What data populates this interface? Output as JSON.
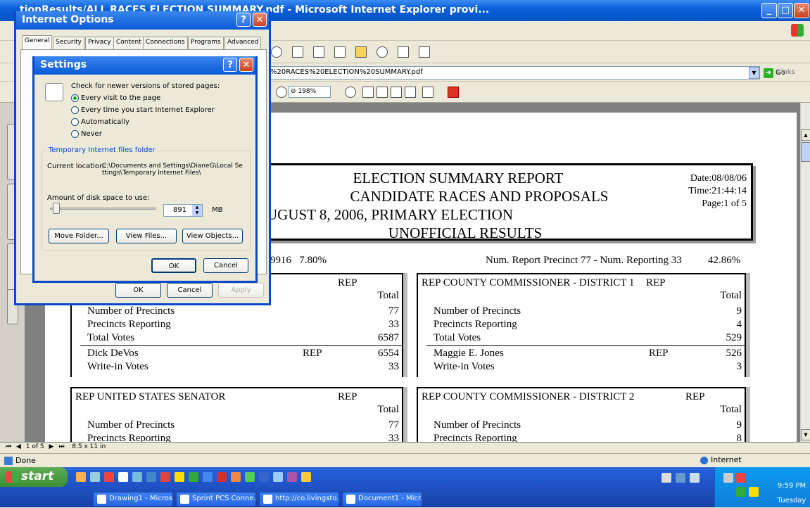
{
  "window": {
    "title": "tionResults/ALL RACES ELECTION SUMMARY.pdf - Microsoft Internet Explorer provi...",
    "address": "%20RACES%20ELECTION%20SUMMARY.pdf",
    "go_label": "Go",
    "links_label": "Links",
    "zoom": "198%",
    "status_done": "Done",
    "zone": "Internet",
    "pdf_page_indicator": "1 of 5",
    "pdf_page_size": "8.5 x 11 in"
  },
  "internet_options": {
    "title": "Internet Options",
    "tabs": [
      "General",
      "Security",
      "Privacy",
      "Content",
      "Connections",
      "Programs",
      "Advanced"
    ],
    "ok": "OK",
    "cancel": "Cancel",
    "apply": "Apply"
  },
  "settings": {
    "title": "Settings",
    "check_label": "Check for newer versions of stored pages:",
    "options": [
      "Every visit to the page",
      "Every time you start Internet Explorer",
      "Automatically",
      "Never"
    ],
    "selected_option": 0,
    "temp_group": "Temporary Internet files folder",
    "current_location_label": "Current location:",
    "current_location_value": "C:\\Documents and Settings\\DianeG\\Local Settings\\Temporary Internet Files\\",
    "disk_space_label": "Amount of disk space to use:",
    "disk_space_value": "891",
    "disk_space_unit": "MB",
    "move_folder": "Move Folder...",
    "view_files": "View Files...",
    "view_objects": "View Objects...",
    "ok": "OK",
    "cancel": "Cancel"
  },
  "report": {
    "title_line1": "ELECTION SUMMARY REPORT",
    "title_line2": "CANDIDATE RACES AND PROPOSALS",
    "title_line3": "UGUST 8, 2006, PRIMARY ELECTION",
    "title_line4": "UNOFFICIAL RESULTS",
    "date": "Date:08/08/06",
    "time": "Time:21:44:14",
    "page": "Page:1 of 5",
    "left_stat": "9916   7.80%",
    "right_stat": "Num. Report Precinct 77 - Num. Reporting 33",
    "right_stat_pct": "42.86%",
    "races": [
      {
        "name": "",
        "party": "REP",
        "total_label": "Total",
        "stats": [
          [
            "Number of Precincts",
            "77"
          ],
          [
            "Precincts Reporting",
            "33"
          ],
          [
            "Total Votes",
            "6587"
          ]
        ],
        "candidates": [
          [
            "Dick DeVos",
            "REP",
            "6554"
          ],
          [
            "Write-in Votes",
            "",
            "33"
          ]
        ]
      },
      {
        "name": "REP COUNTY COMMISSIONER - DISTRICT 1",
        "party": "REP",
        "total_label": "Total",
        "stats": [
          [
            "Number of Precincts",
            "9"
          ],
          [
            "Precincts Reporting",
            "4"
          ],
          [
            "Total Votes",
            "529"
          ]
        ],
        "candidates": [
          [
            "Maggie E. Jones",
            "REP",
            "526"
          ],
          [
            "Write-in Votes",
            "",
            "3"
          ]
        ]
      },
      {
        "name": "REP UNITED STATES SENATOR",
        "party": "REP",
        "total_label": "Total",
        "stats": [
          [
            "Number of Precincts",
            "77"
          ],
          [
            "Precincts Reporting",
            "33"
          ]
        ]
      },
      {
        "name": "REP COUNTY COMMISSIONER - DISTRICT 2",
        "party": "REP",
        "total_label": "Total",
        "stats": [
          [
            "Number of Precincts",
            "9"
          ],
          [
            "Precincts Reporting",
            "8"
          ]
        ]
      }
    ]
  },
  "taskbar": {
    "start": "start",
    "tasks": [
      "Drawing1 - Micros...",
      "Sprint PCS Conne...",
      "http://co.livingsto...",
      "Document1 - Micr..."
    ],
    "time": "9:59 PM",
    "day": "Tuesday"
  }
}
